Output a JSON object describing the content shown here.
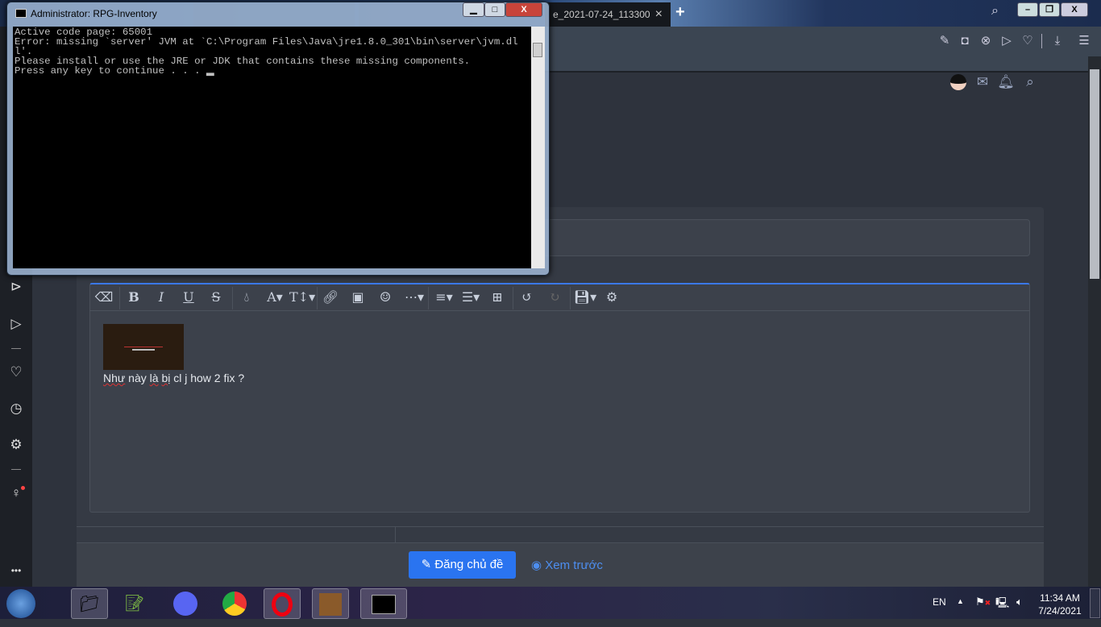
{
  "browser": {
    "active_tab": "e_2021-07-24_113300",
    "new_tab": "+",
    "tab_close": "×",
    "toolbar_icons": [
      "edit-snapshot-icon",
      "camera-icon",
      "adblock-icon",
      "send-icon",
      "heart-icon",
      "download-icon",
      "easy-setup-icon"
    ]
  },
  "sidebar": {
    "icons": [
      "player-icon",
      "send-icon",
      "heart-icon",
      "history-icon",
      "settings-icon",
      "lightbulb-icon",
      "more-icon"
    ],
    "more": "•••"
  },
  "console": {
    "title": "Administrator:  RPG-Inventory",
    "text": "Active code page: 65001\nError: missing `server' JVM at `C:\\Program Files\\Java\\jre1.8.0_301\\bin\\server\\jvm.dll'.\nPlease install or use the JRE or JDK that contains these missing components.\nPress any key to continue . . . ▂"
  },
  "editor": {
    "message_plain1": "Như",
    "message_plain2": " này ",
    "message_sp1": "là",
    "message_sp2": "bị",
    "message_plain3": " cl j how 2 fix ?"
  },
  "actions": {
    "post": "Đăng chủ đề",
    "preview": "Xem trước"
  },
  "tray": {
    "lang": "EN",
    "time": "11:34 AM",
    "date": "7/24/2021"
  }
}
